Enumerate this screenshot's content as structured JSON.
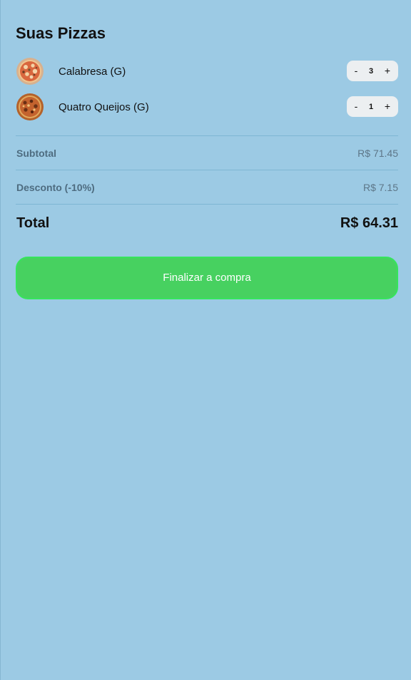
{
  "page": {
    "title": "Suas Pizzas"
  },
  "cart": {
    "items": [
      {
        "name": "Calabresa (G)",
        "quantity": "3",
        "minus_label": "-",
        "plus_label": "+",
        "thumbnail": "pizza-calabresa"
      },
      {
        "name": "Quatro Queijos (G)",
        "quantity": "1",
        "minus_label": "-",
        "plus_label": "+",
        "thumbnail": "pizza-quatro-queijos"
      }
    ]
  },
  "summary": {
    "subtotal_label": "Subtotal",
    "subtotal_value": "R$ 71.45",
    "discount_label": "Desconto (-10%)",
    "discount_value": "R$ 7.15",
    "total_label": "Total",
    "total_value": "R$ 64.31"
  },
  "actions": {
    "checkout_label": "Finalizar a compra"
  },
  "colors": {
    "background": "#9ccae4",
    "checkout": "#47d160",
    "divider": "#7db5d3"
  }
}
